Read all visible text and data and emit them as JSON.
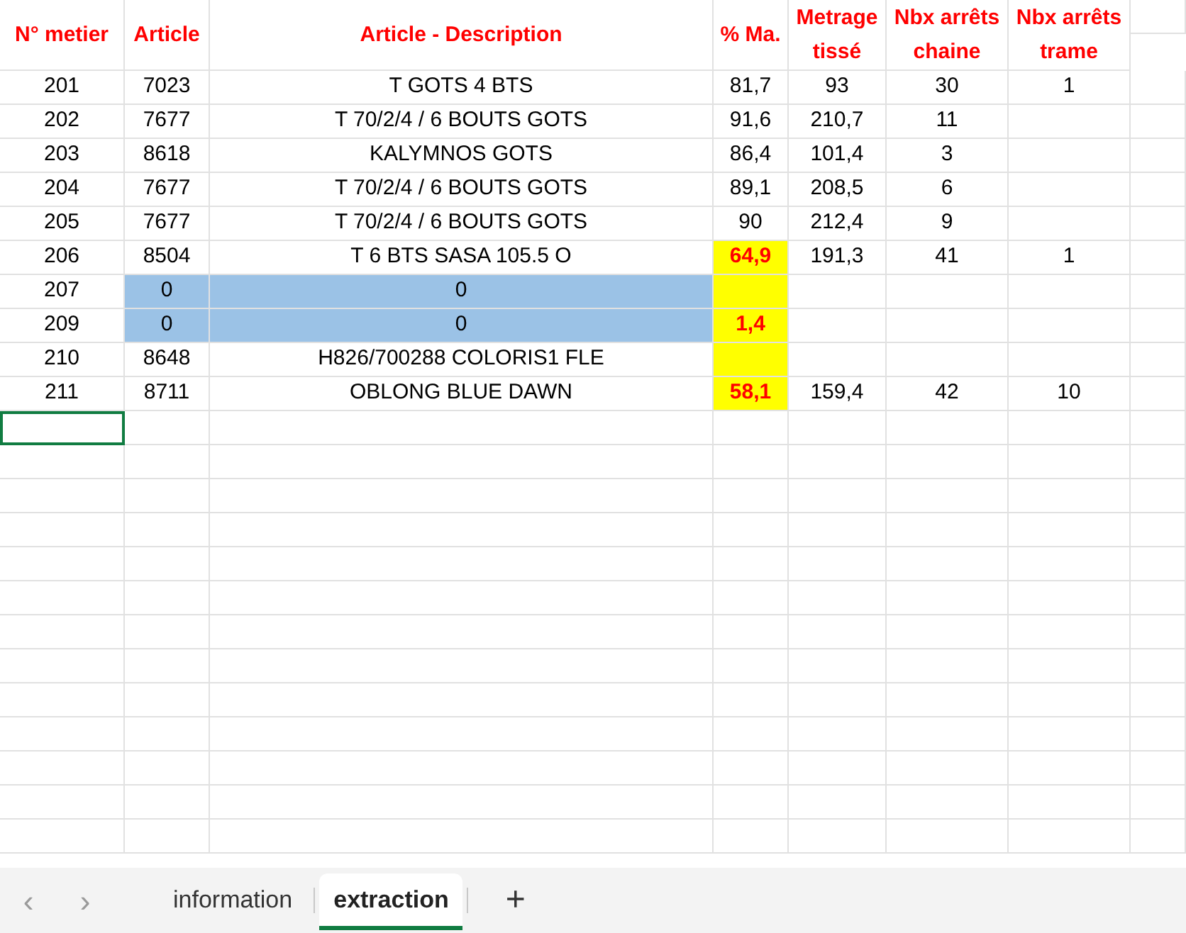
{
  "columns": [
    "N° metier",
    "Article",
    "Article - Description",
    "% Ma.",
    "Metrage tissé",
    "Nbx arrêts chaine",
    "Nbx arrêts trame"
  ],
  "rows": [
    {
      "no": "201",
      "article": "7023",
      "description": "T GOTS  4 BTS",
      "pct": "81,7",
      "metrage": "93",
      "chaine": "30",
      "trame": "1",
      "pct_alert": false,
      "masked": false
    },
    {
      "no": "202",
      "article": "7677",
      "description": "T 70/2/4 / 6 BOUTS GOTS",
      "pct": "91,6",
      "metrage": "210,7",
      "chaine": "11",
      "pct_alert": false,
      "masked": false
    },
    {
      "no": "203",
      "article": "8618",
      "description": "KALYMNOS GOTS",
      "pct": "86,4",
      "metrage": "101,4",
      "chaine": "3",
      "pct_alert": false,
      "masked": false
    },
    {
      "no": "204",
      "article": "7677",
      "description": "T 70/2/4 / 6 BOUTS GOTS",
      "pct": "89,1",
      "metrage": "208,5",
      "chaine": "6",
      "pct_alert": false,
      "masked": false
    },
    {
      "no": "205",
      "article": "7677",
      "description": "T 70/2/4 / 6 BOUTS GOTS",
      "pct": "90",
      "metrage": "212,4",
      "chaine": "9",
      "pct_alert": false,
      "masked": false
    },
    {
      "no": "206",
      "article": "8504",
      "description": "T 6 BTS SASA 105.5 O",
      "pct": "64,9",
      "metrage": "191,3",
      "chaine": "41",
      "trame": "1",
      "pct_alert": true,
      "masked": false
    },
    {
      "no": "207",
      "article": "0",
      "description": "0",
      "pct_alert": true,
      "masked": true
    },
    {
      "no": "209",
      "article": "0",
      "description": "0",
      "pct": "1,4",
      "pct_alert": true,
      "masked": true
    },
    {
      "no": "210",
      "article": "8648",
      "description": "H826/700288 COLORIS1 FLE",
      "pct_alert": true,
      "masked": false
    },
    {
      "no": "211",
      "article": "8711",
      "description": "OBLONG BLUE DAWN",
      "pct": "58,1",
      "metrage": "159,4",
      "chaine": "42",
      "trame": "10",
      "pct_alert": true,
      "masked": false
    }
  ],
  "cell_cursor": true,
  "sheet_nav": [
    "‹",
    "›"
  ],
  "sheet_tabs": [
    {
      "label": "information",
      "selected": false
    },
    {
      "label": "extraction",
      "selected": true
    }
  ],
  "add_sheet": "+"
}
